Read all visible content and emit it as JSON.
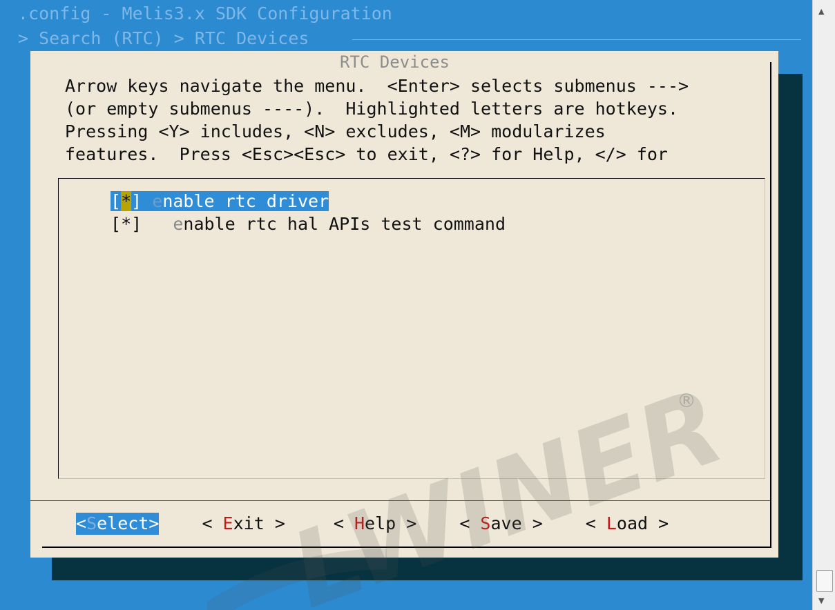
{
  "window": {
    "title": ".config - Melis3.x SDK Configuration",
    "breadcrumb": "> Search (RTC) > RTC Devices"
  },
  "dialog": {
    "title": "RTC Devices",
    "help_lines": [
      "Arrow keys navigate the menu.  <Enter> selects submenus --->",
      "(or empty submenus ----).  Highlighted letters are hotkeys.",
      "Pressing <Y> includes, <N> excludes, <M> modularizes",
      "features.  Press <Esc><Esc> to exit, <?> for Help, </> for"
    ]
  },
  "menu": {
    "items": [
      {
        "bracket_open": "[",
        "mark": "*",
        "bracket_close": "]",
        "hotkey": "e",
        "label_rest": "nable rtc driver",
        "selected": true
      },
      {
        "bracket_open": "[",
        "mark": "*",
        "bracket_close": "]",
        "hotkey": "e",
        "label_rest": "nable rtc hal APIs test command",
        "selected": false
      }
    ]
  },
  "buttons": [
    {
      "pre": "<",
      "hotkey": "S",
      "post": "elect>",
      "selected": true
    },
    {
      "pre": "< ",
      "hotkey": "E",
      "post": "xit >",
      "selected": false
    },
    {
      "pre": "< ",
      "hotkey": "H",
      "post": "elp >",
      "selected": false
    },
    {
      "pre": "< ",
      "hotkey": "S",
      "post": "ave >",
      "selected": false
    },
    {
      "pre": "< ",
      "hotkey": "L",
      "post": "oad >",
      "selected": false
    }
  ],
  "watermark": {
    "text": "LWINER",
    "registered": "®"
  },
  "scrollbar": {
    "up_icon": "triangle-up",
    "down_icon": "triangle-down"
  }
}
